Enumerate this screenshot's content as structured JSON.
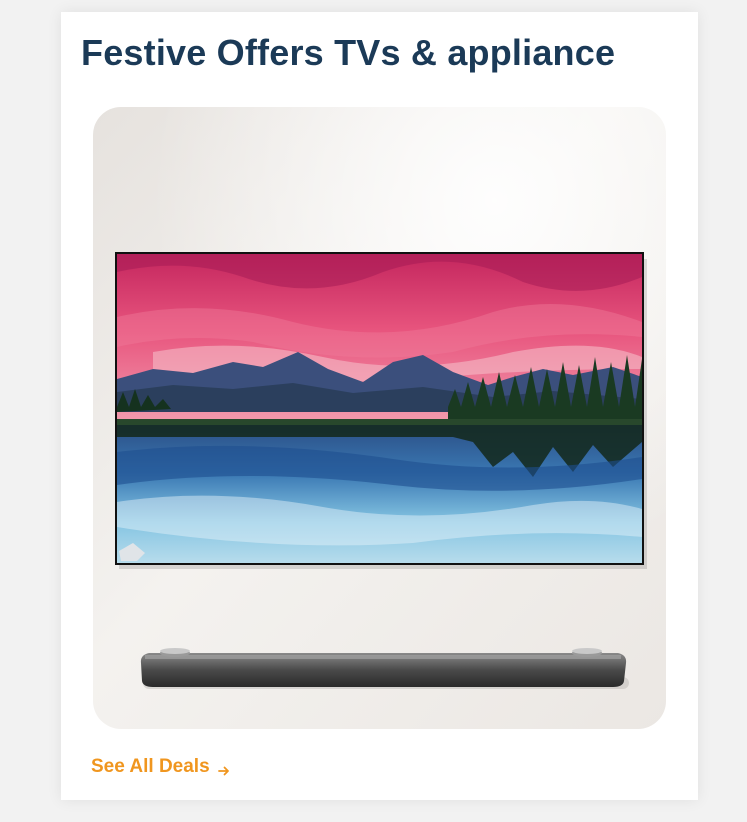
{
  "card": {
    "title": "Festive Offers TVs & appliance",
    "link_label": "See All Deals",
    "link_icon": "arrow-right-icon"
  },
  "colors": {
    "title": "#1b3a57",
    "link": "#f0961f",
    "card_background": "#ffffff",
    "page_background": "#f2f2f2"
  },
  "image": {
    "subject": "wall-mounted-tv-with-soundbar"
  }
}
